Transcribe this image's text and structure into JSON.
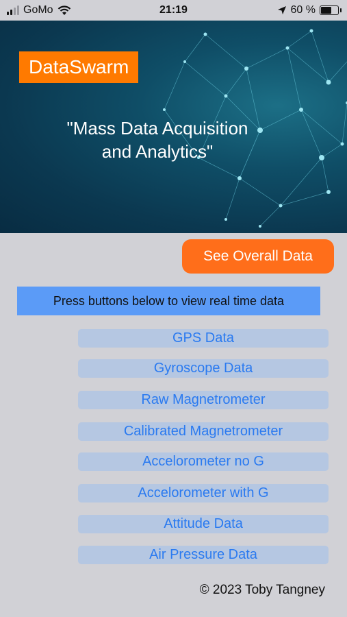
{
  "status_bar": {
    "carrier": "GoMo",
    "time": "21:19",
    "battery": "60 %"
  },
  "header": {
    "brand": "DataSwarm",
    "tagline_line1": "\"Mass Data Acquisition",
    "tagline_line2": "and Analytics\""
  },
  "overall_button": {
    "label": "See Overall Data"
  },
  "instruction": {
    "text": "Press buttons below to view real time data"
  },
  "data_buttons": [
    {
      "label": "GPS Data"
    },
    {
      "label": "Gyroscope Data"
    },
    {
      "label": "Raw Magnetrometer"
    },
    {
      "label": "Calibrated Magnetrometer"
    },
    {
      "label": "Accelorometer no G"
    },
    {
      "label": "Accelorometer with G"
    },
    {
      "label": "Attitude Data"
    },
    {
      "label": "Air Pressure Data"
    }
  ],
  "footer": {
    "copyright": "© 2023 Toby Tangney"
  },
  "colors": {
    "accent_orange": "#ff6e1a",
    "instruction_blue": "#5b9bf7",
    "button_text_blue": "#2a7af0",
    "button_bg": "#b5c7e2",
    "background": "#d1d1d6"
  }
}
